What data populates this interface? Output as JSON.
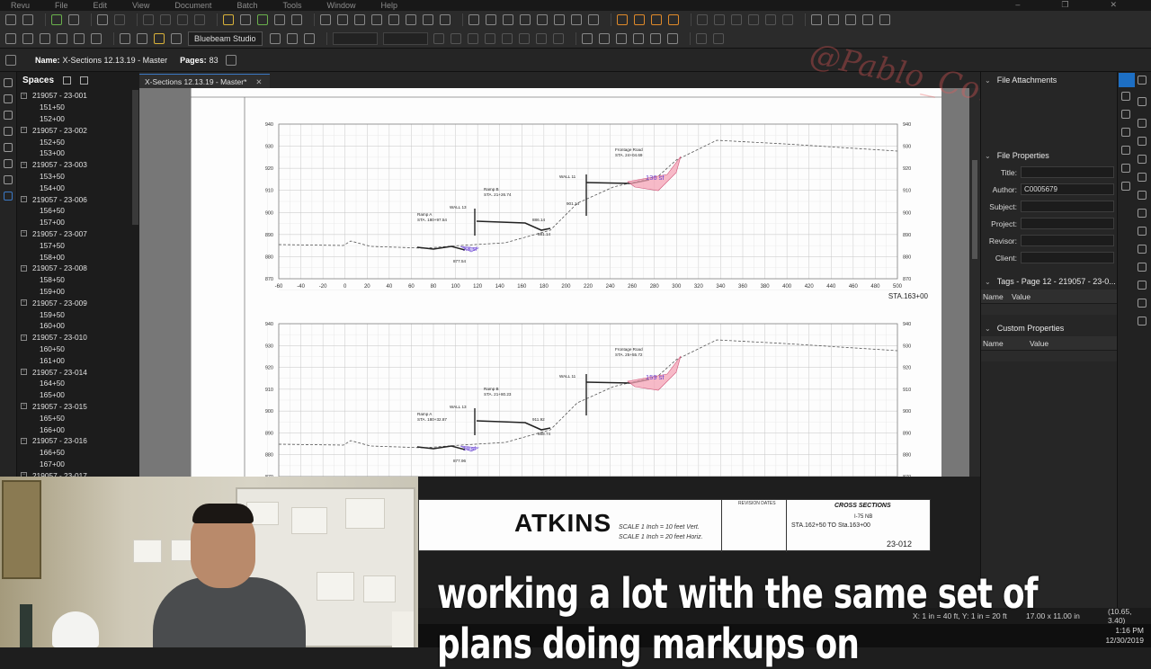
{
  "menu": [
    "Revu",
    "File",
    "Edit",
    "View",
    "Document",
    "Batch",
    "Tools",
    "Window",
    "Help"
  ],
  "toolbar": {
    "profile": "Bluebeam Studio"
  },
  "document": {
    "name_label": "Name:",
    "name_value": "X-Sections 12.13.19 - Master",
    "pages_label": "Pages:",
    "pages_value": "83",
    "tab_title": "X-Sections 12.13.19 - Master*"
  },
  "spaces": {
    "title": "Spaces",
    "groups": [
      {
        "name": "219057 - 23-001",
        "children": [
          "151+50",
          "152+00"
        ]
      },
      {
        "name": "219057 - 23-002",
        "children": [
          "152+50",
          "153+00"
        ]
      },
      {
        "name": "219057 - 23-003",
        "children": [
          "153+50",
          "154+00"
        ]
      },
      {
        "name": "219057 - 23-006",
        "children": [
          "156+50",
          "157+00"
        ]
      },
      {
        "name": "219057 - 23-007",
        "children": [
          "157+50",
          "158+00"
        ]
      },
      {
        "name": "219057 - 23-008",
        "children": [
          "158+50",
          "159+00"
        ]
      },
      {
        "name": "219057 - 23-009",
        "children": [
          "159+50",
          "160+00"
        ]
      },
      {
        "name": "219057 - 23-010",
        "children": [
          "160+50",
          "161+00"
        ]
      },
      {
        "name": "219057 - 23-014",
        "children": [
          "164+50",
          "165+00"
        ]
      },
      {
        "name": "219057 - 23-015",
        "children": [
          "165+50",
          "166+00"
        ]
      },
      {
        "name": "219057 - 23-016",
        "children": [
          "166+50",
          "167+00"
        ]
      },
      {
        "name": "219057 - 23-017",
        "children": []
      }
    ]
  },
  "drawing": {
    "x_ticks": [
      "-60",
      "-40",
      "-20",
      "0",
      "20",
      "40",
      "60",
      "80",
      "100",
      "120",
      "140",
      "160",
      "180",
      "200",
      "220",
      "240",
      "260",
      "280",
      "300",
      "320",
      "340",
      "360",
      "380",
      "400",
      "420",
      "440",
      "460",
      "480",
      "500"
    ],
    "y_ticks_top": [
      "940",
      "930",
      "920",
      "910",
      "900",
      "890",
      "880",
      "870"
    ],
    "y_ticks_bottom": [
      "940",
      "930",
      "920",
      "910",
      "900",
      "890",
      "880",
      "870"
    ],
    "station_top": "STA.163+00",
    "station_bottom": "STA.162+50",
    "fill_top": "136 sf",
    "fill_bottom": "159 sf",
    "cut_top": "XX sf",
    "cut_bottom": "10 sf",
    "labels_top": [
      "Frontage Road",
      "STA. 24+04.69",
      "Ramp B",
      "STA. 21+26.74",
      "Ramp A",
      "STA. 180+97.54",
      "WALL 13",
      "WALL 11",
      "877.54",
      "881.14",
      "886.14",
      "901.14"
    ],
    "labels_bottom": [
      "Frontage Road",
      "STA. 25+55.72",
      "Ramp B",
      "STA. 21+80.23",
      "Ramp A",
      "STA. 180+32.87",
      "WALL 13",
      "WALL 11",
      "877.96",
      "888.74",
      "911.92"
    ],
    "title_block": {
      "logo": "ATKINS",
      "scale_vert": "SCALE 1 Inch = 10 feet Vert.",
      "scale_horiz": "SCALE 1 Inch = 20 feet Horiz.",
      "revisions": "REVISION DATES",
      "sheet_title": "CROSS SECTIONS",
      "road": "I-75 NB",
      "station_range": "STA.162+50  TO  Sta.163+00",
      "sheet_number": "23-012"
    }
  },
  "right_panel": {
    "attachments": "File Attachments",
    "properties": "File Properties",
    "fields": [
      {
        "key": "Title:",
        "value": ""
      },
      {
        "key": "Author:",
        "value": "C0005679"
      },
      {
        "key": "Subject:",
        "value": ""
      },
      {
        "key": "Project:",
        "value": ""
      },
      {
        "key": "Revisor:",
        "value": ""
      },
      {
        "key": "Client:",
        "value": ""
      }
    ],
    "tags_title": "Tags - Page 12 - 219057 - 23-0...",
    "tags_cols": [
      "Name",
      "Value"
    ],
    "custom_title": "Custom Properties",
    "custom_cols": [
      "Name",
      "Value"
    ]
  },
  "status": {
    "scale": "X: 1 in = 40 ft, Y: 1 in = 20 ft",
    "size": "17.00 x 11.00 in",
    "coords": "(10.65, 3.40)"
  },
  "clock": {
    "time": "1:16 PM",
    "date": "12/30/2019"
  },
  "watermark": "@Pablo_Contech",
  "caption": {
    "line1": "working a lot with the same set of",
    "line2": "plans doing markups on"
  },
  "colors": {
    "accent": "#1d6fc4",
    "fill_markup": "#f4a3b6",
    "cut_markup": "#7c5cd6"
  }
}
